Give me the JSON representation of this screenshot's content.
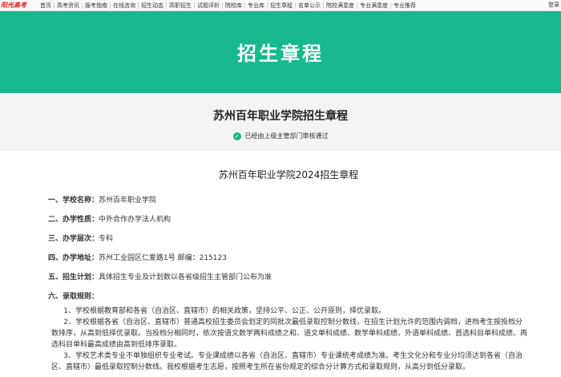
{
  "topnav": {
    "logo": "阳光高考",
    "items": [
      "首页",
      "高考资讯",
      "报考指南",
      "在线咨询",
      "招生动态",
      "高职招生",
      "试题评析",
      "院校库",
      "专业库",
      "招生章程",
      "名单公示",
      "院校满意度",
      "专业满意度",
      "专业推荐"
    ],
    "login": "登录"
  },
  "banner": {
    "title": "招生章程"
  },
  "header": {
    "page_title": "苏州百年职业学院招生章程",
    "verify_text": "已经由上级主管部门审核通过"
  },
  "article": {
    "title": "苏州百年职业学院2024招生章程",
    "fields": [
      {
        "label": "一、学校名称：",
        "value": "苏州百年职业学院"
      },
      {
        "label": "二、办学性质：",
        "value": "中外合作办学法人机构"
      },
      {
        "label": "三、办学层次：",
        "value": "专科"
      },
      {
        "label": "四、办学地址：",
        "value": "苏州工业园区仁爱路1号   邮编：215123"
      },
      {
        "label": "五、招生计划：",
        "value": "具体招生专业及计划数以各省级招生主管部门公布为准"
      }
    ],
    "rules_heading": "六、录取规则：",
    "paragraphs": [
      "1、学校根据教育部和各省（自治区、直辖市）的相关政策，坚持公平、公正、公开原则，择优录取。",
      "2、学校根据各省（自治区、直辖市）普通高校招生委员会划定的同批次最低录取控制分数线，在招生计划允许的范围内调档，进档考生按投档分数排序，从高到低择优录取。当投档分相同时，依次按语文数学两科成绩之和、语文单科成绩、数学单科成绩、外语单科成绩、首选科目单科成绩、再选科目单科最高成绩由高到低排序录取。",
      "3、学校艺术类专业不单独组织专业考试。专业课成绩以各省（自治区、直辖市）专业课统考成绩为准。考生文化分和专业分均须达到各省（自治区、直辖市）最低录取控制分数线。我校根据考生志愿，按照考生所在省份规定的综合分计算方式和录取规则，从高分到低分录取。"
    ]
  }
}
